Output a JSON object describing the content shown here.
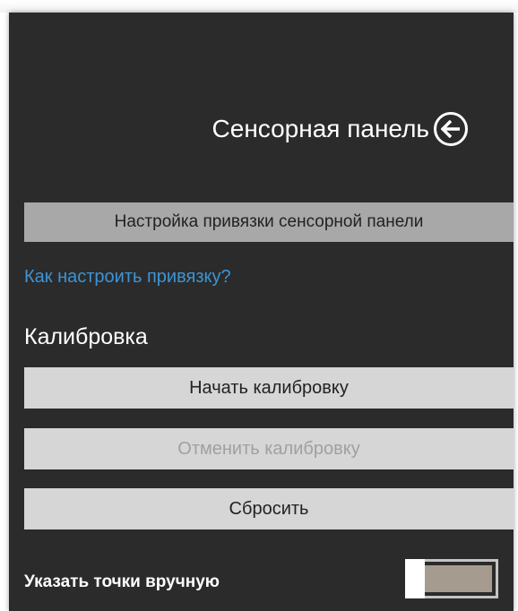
{
  "header": {
    "title": "Сенсорная панель",
    "back_icon": "arrow-left-circle-icon"
  },
  "binding": {
    "button_label": "Настройка привязки сенсорной панели",
    "help_link": "Как настроить привязку?"
  },
  "calibration": {
    "section_title": "Калибровка",
    "start_label": "Начать калибровку",
    "cancel_label": "Отменить калибровку",
    "cancel_enabled": false,
    "reset_label": "Сбросить"
  },
  "manual_points": {
    "label": "Указать точки вручную",
    "toggle_state": "off"
  },
  "colors": {
    "panel_background": "#2b2b2b",
    "link": "#3d94d6",
    "button_light": "#d6d6d6",
    "button_dark": "#a8a8a8",
    "toggle_track": "#a59c8f"
  }
}
